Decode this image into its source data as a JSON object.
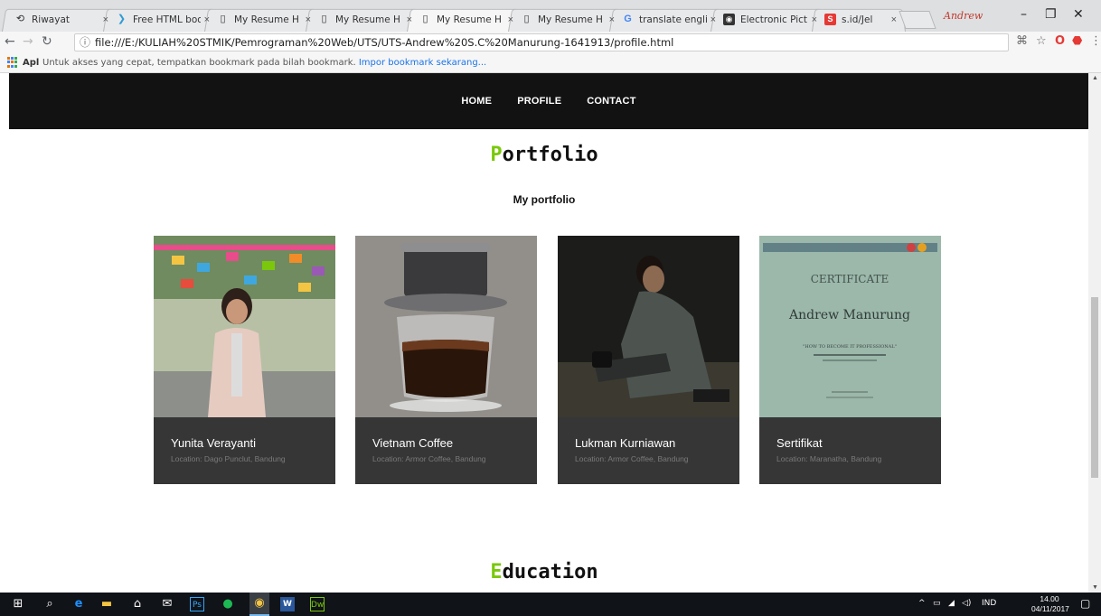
{
  "browser": {
    "tabs": [
      {
        "label": "Riwayat",
        "icon": "history-icon"
      },
      {
        "label": "Free HTML boo",
        "icon": "w3-icon"
      },
      {
        "label": "My Resume H",
        "icon": "page-icon"
      },
      {
        "label": "My Resume H",
        "icon": "page-icon"
      },
      {
        "label": "My Resume H",
        "icon": "page-icon",
        "active": true
      },
      {
        "label": "My Resume H",
        "icon": "page-icon"
      },
      {
        "label": "translate engli",
        "icon": "google-icon"
      },
      {
        "label": "Electronic Pict",
        "icon": "camera-icon"
      },
      {
        "label": "s.id/Jel",
        "icon": "sid-icon"
      }
    ],
    "tab_close_glyph": "×",
    "profile_name": "Andrew",
    "url": "file:///E:/KULIAH%20STMIK/Pemrograman%20Web/UTS/UTS-Andrew%20S.C%20Manurung-1641913/profile.html",
    "bookmarks": {
      "apps_label": "Apl",
      "hint": "Untuk akses yang cepat, tempatkan bookmark pada bilah bookmark.",
      "import_link": "Impor bookmark sekarang..."
    }
  },
  "site": {
    "nav": [
      "HOME",
      "PROFILE",
      "CONTACT"
    ],
    "portfolio": {
      "title_initial": "P",
      "title_rest": "ortfolio",
      "subtitle": "My portfolio",
      "items": [
        {
          "name": "Yunita Verayanti",
          "location": "Location: Dago Punclut, Bandung"
        },
        {
          "name": "Vietnam Coffee",
          "location": "Location: Armor Coffee, Bandung"
        },
        {
          "name": "Lukman Kurniawan",
          "location": "Location: Armor Coffee, Bandung"
        },
        {
          "name": "Sertifikat",
          "location": "Location: Maranatha, Bandung"
        }
      ]
    },
    "education": {
      "title_initial": "E",
      "title_rest": "ducation"
    },
    "certificate": {
      "heading": "CERTIFICATE",
      "recipient": "Andrew Manurung",
      "course": "\"HOW TO BECOME IT PROFESSIONAL\""
    }
  },
  "taskbar": {
    "language": "IND",
    "time": "14.00",
    "date": "04/11/2017"
  },
  "colors": {
    "accent_green": "#7ac70c",
    "nav_bg": "#121212",
    "card_bg": "#363636"
  }
}
